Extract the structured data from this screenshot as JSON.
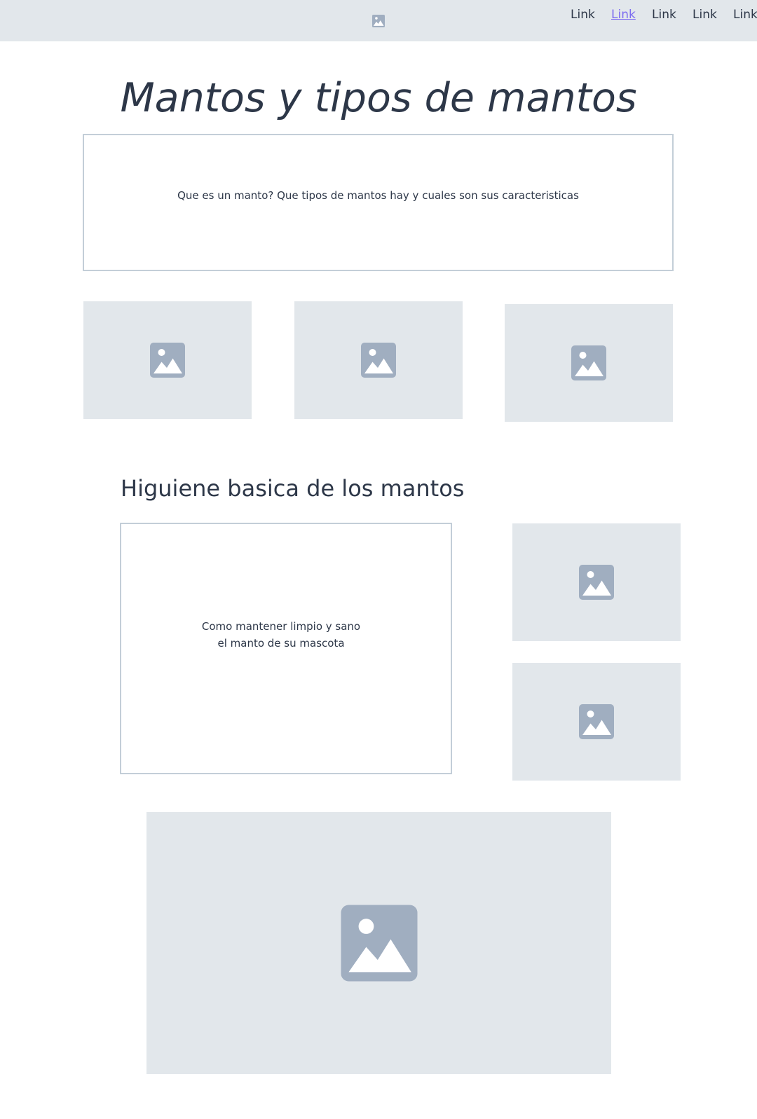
{
  "nav": {
    "logo_icon": "image-icon",
    "links": [
      "Link",
      "Link",
      "Link",
      "Link",
      "Link"
    ],
    "active_index": 1,
    "active_color": "#7c6cf0"
  },
  "hero": {
    "title": "Mantos y tipos de mantos"
  },
  "intro_box": {
    "text": "Que es un manto? Que tipos de mantos hay y cuales son sus caracteristicas"
  },
  "section": {
    "heading": "Higuiene basica de los mantos",
    "box_line1": "Como mantener limpio y sano",
    "box_line2": "el manto de su mascota"
  },
  "colors": {
    "text": "#2d3748",
    "placeholder_bg": "#e2e7eb",
    "placeholder_icon": "#a0aec0",
    "border": "#c3ced8"
  }
}
